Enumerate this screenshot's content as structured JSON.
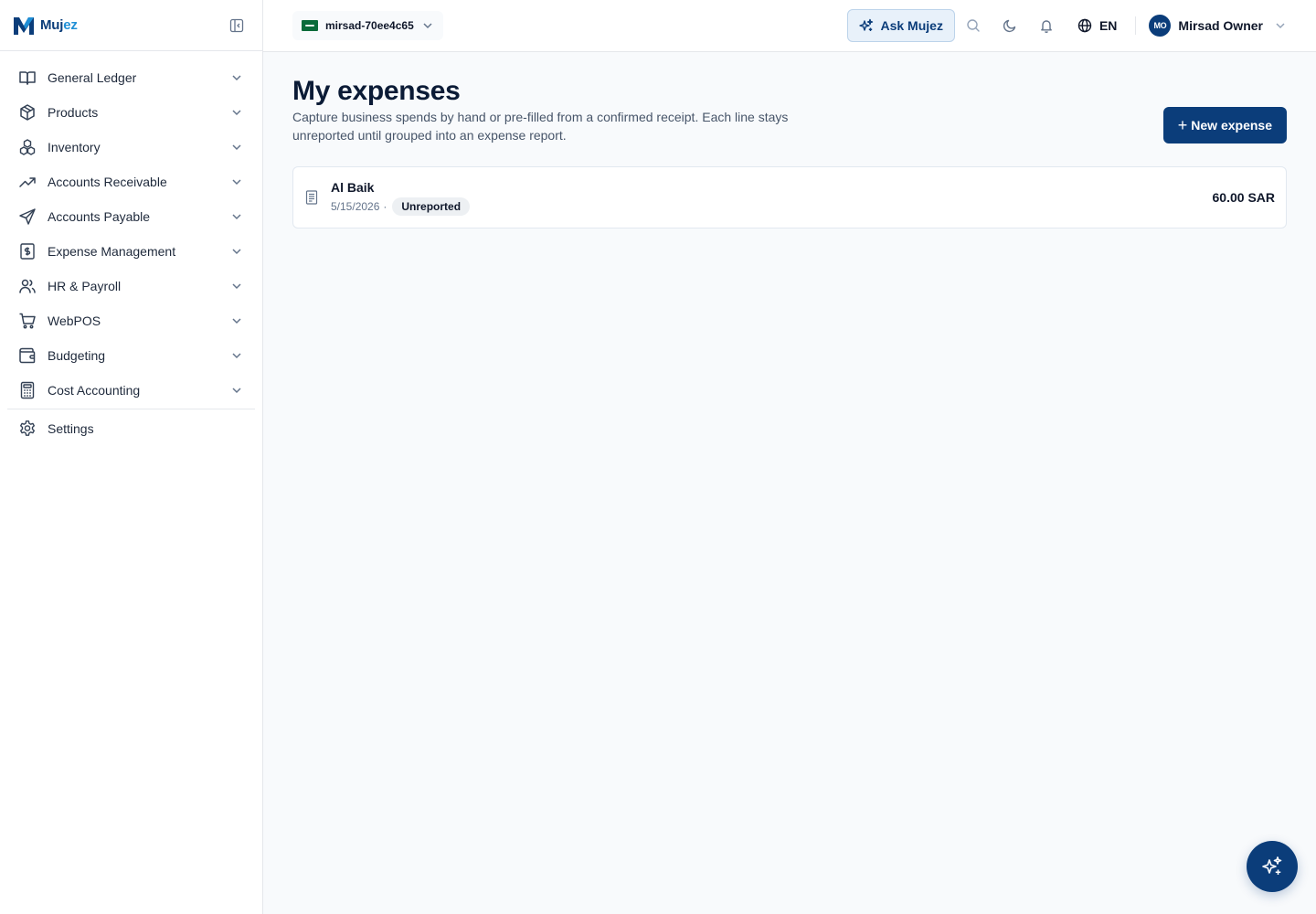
{
  "brand": {
    "name_prefix": "Muj",
    "name_suffix": "ez"
  },
  "sidebar": {
    "items": [
      {
        "label": "General Ledger",
        "icon": "book-open-icon"
      },
      {
        "label": "Products",
        "icon": "package-icon"
      },
      {
        "label": "Inventory",
        "icon": "boxes-icon"
      },
      {
        "label": "Accounts Receivable",
        "icon": "trending-up-icon"
      },
      {
        "label": "Accounts Payable",
        "icon": "send-icon"
      },
      {
        "label": "Expense Management",
        "icon": "receipt-dollar-icon"
      },
      {
        "label": "HR & Payroll",
        "icon": "users-icon"
      },
      {
        "label": "WebPOS",
        "icon": "shopping-cart-icon"
      },
      {
        "label": "Budgeting",
        "icon": "wallet-icon"
      },
      {
        "label": "Cost Accounting",
        "icon": "calculator-icon"
      }
    ],
    "settings_label": "Settings"
  },
  "topbar": {
    "org_name": "mirsad-70ee4c65",
    "ask_label": "Ask Mujez",
    "language": "EN",
    "user_initials": "MO",
    "user_name": "Mirsad Owner"
  },
  "page": {
    "title": "My expenses",
    "subtitle": "Capture business spends by hand or pre-filled from a confirmed receipt. Each line stays unreported until grouped into an expense report.",
    "new_button_label": "New expense"
  },
  "expenses": [
    {
      "merchant": "Al Baik",
      "date": "5/15/2026",
      "separator": "·",
      "status": "Unreported",
      "amount": "60.00 SAR"
    }
  ],
  "colors": {
    "primary": "#0b3d7a",
    "accent": "#1f8fd6",
    "background": "#f8fafc"
  }
}
